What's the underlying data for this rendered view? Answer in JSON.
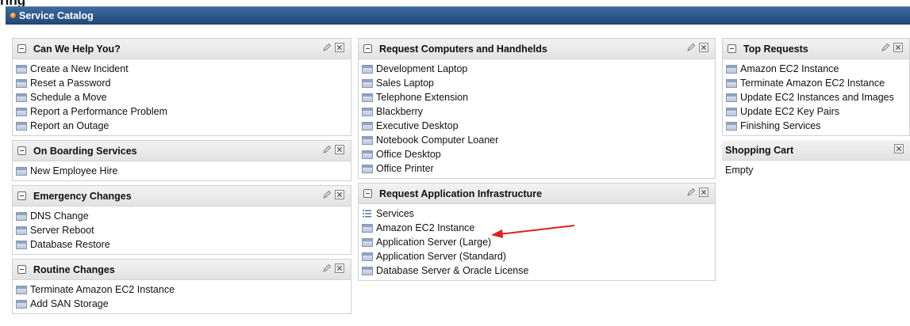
{
  "page_heading_fragment": "ring",
  "banner": {
    "title": "Service Catalog"
  },
  "panels": {
    "can_we_help": {
      "title": "Can We Help You?",
      "items": [
        "Create a New Incident",
        "Reset a Password",
        "Schedule a Move",
        "Report a Performance Problem",
        "Report an Outage"
      ]
    },
    "on_boarding": {
      "title": "On Boarding Services",
      "items": [
        "New Employee Hire"
      ]
    },
    "emergency": {
      "title": "Emergency Changes",
      "items": [
        "DNS Change",
        "Server Reboot",
        "Database Restore"
      ]
    },
    "routine": {
      "title": "Routine Changes",
      "items": [
        "Terminate Amazon EC2 Instance",
        "Add SAN Storage"
      ]
    },
    "computers": {
      "title": "Request Computers and Handhelds",
      "items": [
        "Development Laptop",
        "Sales Laptop",
        "Telephone Extension",
        "Blackberry",
        "Executive Desktop",
        "Notebook Computer Loaner",
        "Office Desktop",
        "Office Printer"
      ]
    },
    "app_infra": {
      "title": "Request Application Infrastructure",
      "items": [
        "Services",
        "Amazon EC2 Instance",
        "Application Server (Large)",
        "Application Server (Standard)",
        "Database Server & Oracle License"
      ]
    },
    "top_requests": {
      "title": "Top Requests",
      "items": [
        "Amazon EC2 Instance",
        "Terminate Amazon EC2 Instance",
        "Update EC2 Instances and Images",
        "Update EC2 Key Pairs",
        "Finishing Services"
      ]
    },
    "shopping_cart": {
      "title": "Shopping Cart",
      "status": "Empty"
    }
  },
  "icons": {
    "item": "catalog-item-icon",
    "category": "list-icon",
    "edit": "pencil-icon",
    "close": "close-box-icon",
    "collapse": "collapse-toggle-icon"
  },
  "colors": {
    "banner_top": "#3d6a9e",
    "banner_bottom": "#22497a",
    "annotation_arrow": "#e02020"
  }
}
